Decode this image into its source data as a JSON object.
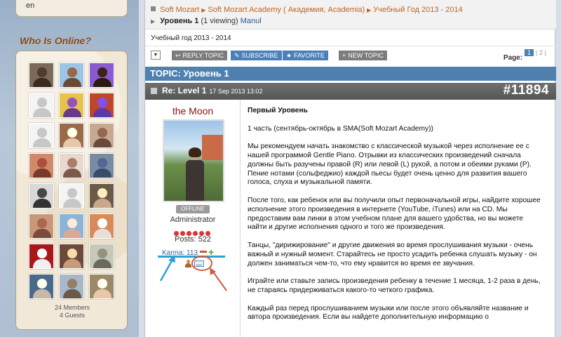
{
  "sidebar": {
    "language": "en",
    "who_is_online_title": "Who Is Online?",
    "members_count": "24 Members",
    "guests_count": "4 Guests",
    "avatars": [
      {
        "kind": "photo",
        "bg": "#7b6a58",
        "fg": "#3a2a20"
      },
      {
        "kind": "photo",
        "bg": "#9cc4e4",
        "fg": "#6b4a34"
      },
      {
        "kind": "photo",
        "bg": "#8a5ad0",
        "fg": "#2a1a10"
      },
      {
        "kind": "blank"
      },
      {
        "kind": "photo",
        "bg": "#e6c34a",
        "fg": "#6a3a8a"
      },
      {
        "kind": "photo",
        "bg": "#c0462a",
        "fg": "#5a3aa8"
      },
      {
        "kind": "blank"
      },
      {
        "kind": "photo",
        "bg": "#9a6a4a",
        "fg": "#e8c8a8"
      },
      {
        "kind": "photo",
        "bg": "#c8a890",
        "fg": "#6a4a3a"
      },
      {
        "kind": "photo",
        "bg": "#d08a6a",
        "fg": "#7a3a2a"
      },
      {
        "kind": "photo",
        "bg": "#e8d8d0",
        "fg": "#7a5a4a"
      },
      {
        "kind": "photo",
        "bg": "#7a8aa0",
        "fg": "#3a4a6a"
      },
      {
        "kind": "photo",
        "bg": "#d8d8d8",
        "fg": "#333333"
      },
      {
        "kind": "blank"
      },
      {
        "kind": "photo",
        "bg": "#6a5a4a",
        "fg": "#c8a888"
      },
      {
        "kind": "photo",
        "bg": "#c89878",
        "fg": "#7a4a3a"
      },
      {
        "kind": "photo",
        "bg": "#8ab4d8",
        "fg": "#d8a898"
      },
      {
        "kind": "photo",
        "bg": "#d88a5a",
        "fg": "#e8e0d8"
      },
      {
        "kind": "photo",
        "bg": "#a81818",
        "fg": "#f0f0f0"
      },
      {
        "kind": "photo",
        "bg": "#6a4a3a",
        "fg": "#c89a7a"
      },
      {
        "kind": "photo",
        "bg": "#c8c8b8",
        "fg": "#6a6a5a"
      },
      {
        "kind": "photo",
        "bg": "#4a6a8a",
        "fg": "#c8b8a8"
      },
      {
        "kind": "photo",
        "bg": "#a8b8c8",
        "fg": "#6a5a4a"
      },
      {
        "kind": "photo",
        "bg": "#9a8a6a",
        "fg": "#e8c8a8"
      }
    ]
  },
  "breadcrumb": {
    "items": [
      "Soft Mozart",
      "Soft Mozart Academy ( Академия, Academia)",
      "Учебный Год 2013 - 2014"
    ],
    "current_topic": "Уровень 1",
    "viewing": "(1 viewing)",
    "viewer": "Manul"
  },
  "year_label": "Учебный год 2013 - 2014",
  "toolbar": {
    "reply_label": "REPLY TOPIC",
    "subscribe_label": "SUBSCRIBE",
    "favorite_label": "FAVORITE",
    "new_topic_label": "NEW TOPIC",
    "page_label": "Page:",
    "current_page": "1",
    "other_page": "2"
  },
  "topic": {
    "title": "TOPIC: Уровень 1"
  },
  "post": {
    "title": "Re: Level 1",
    "date": "17 Sep 2013 13:02",
    "number": "#11894",
    "author": {
      "name": "the Moon",
      "status": "OFFLINE",
      "role": "Administrator",
      "rank_dots": 6,
      "posts": "Posts: 522",
      "karma": "Karma: 113"
    },
    "paragraphs": [
      "Первый Уровень",
      "1 часть (сентябрь-октябрь в SMA(Soft Mozart Academy))",
      "Мы рекомендуем начать знакомство с классической музыкой через исполнение ее с нашей программой Gentle Piano. Отрывки из классических произведений сначала должны быть разучены правой (R) или левой (L) рукой, а потом и обеими руками (P). Пение нотами (сольфеджио) каждой пьесы будет очень ценно для развития вашего голоса, слуха и музыкальной памяти.",
      "После того, как ребенок или вы получили опыт первоначальной игры, найдите хорошее исполнение этого произведения в интернете (YouTube, iTunes) или на CD. Мы предоставим вам линки в этом учебном плане для вашего удобства, но вы можете найти и другие исполнения одного и того же произведения.",
      "Танцы, \"дирижирование\" и другие движения во время прослушивания музыки - очень важный и нужный момент. Старайтесь не просто усадить ребенка слушать музыку - он должен заниматься чем-то, что ему нравится во время ее звучания.",
      "Играйте или ставьте запись произведения ребенку в течение 1 месяца, 1-2 раза в день, не стараясь придерживаться какого-то четкого графика.",
      "Каждый раз перед прослушиванием музыки или после этого объявляйте название и автора произведения. Если вы найдете дополнительную информацию о"
    ]
  },
  "colors": {
    "accent_blue": "#4f80b0",
    "link_orange": "#c0641c",
    "author_red": "#8b1414",
    "annotation_arrow": "#2aa3d4",
    "annotation_circle": "#d35a40"
  }
}
